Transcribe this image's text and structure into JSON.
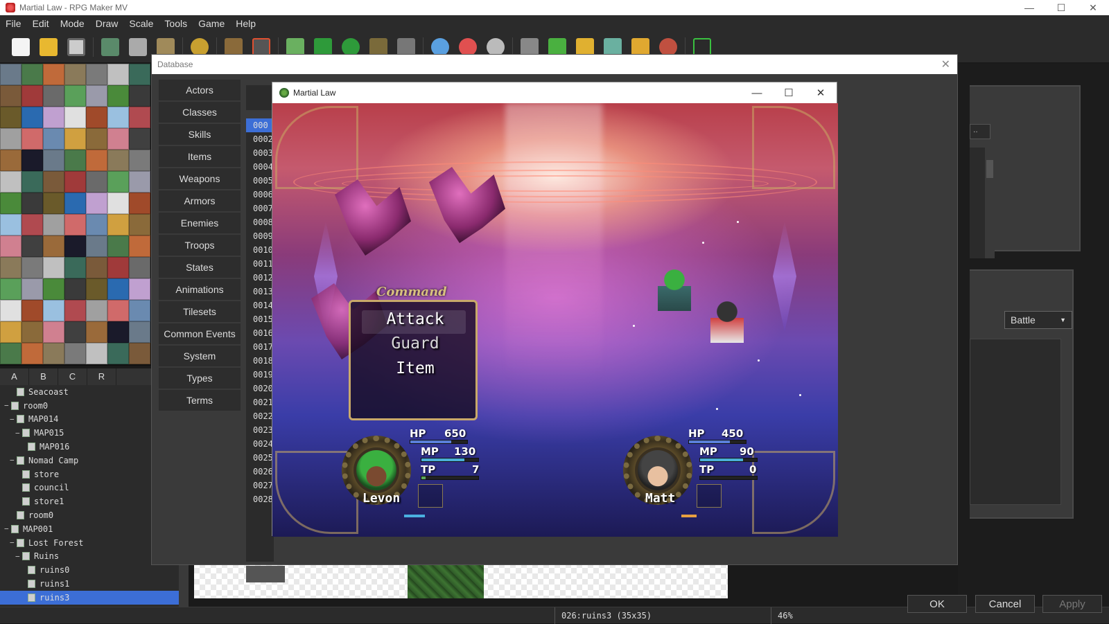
{
  "window": {
    "title": "Martial Law - RPG Maker MV",
    "min": "—",
    "max": "☐",
    "close": "✕"
  },
  "menu": [
    "File",
    "Edit",
    "Mode",
    "Draw",
    "Scale",
    "Tools",
    "Game",
    "Help"
  ],
  "tileset_tabs": [
    "A",
    "B",
    "C",
    "R"
  ],
  "map_tree": [
    {
      "label": "Seacoast",
      "depth": 2,
      "toggle": ""
    },
    {
      "label": "room0",
      "depth": 1,
      "toggle": "−"
    },
    {
      "label": "MAP014",
      "depth": 2,
      "toggle": "−"
    },
    {
      "label": "MAP015",
      "depth": 3,
      "toggle": "−"
    },
    {
      "label": "MAP016",
      "depth": 4,
      "toggle": ""
    },
    {
      "label": "Nomad Camp",
      "depth": 2,
      "toggle": "−"
    },
    {
      "label": "store",
      "depth": 3,
      "toggle": ""
    },
    {
      "label": "council",
      "depth": 3,
      "toggle": ""
    },
    {
      "label": "store1",
      "depth": 3,
      "toggle": ""
    },
    {
      "label": "room0",
      "depth": 2,
      "toggle": ""
    },
    {
      "label": "MAP001",
      "depth": 1,
      "toggle": "−"
    },
    {
      "label": "Lost Forest",
      "depth": 2,
      "toggle": "−"
    },
    {
      "label": "Ruins",
      "depth": 3,
      "toggle": "−"
    },
    {
      "label": "ruins0",
      "depth": 4,
      "toggle": ""
    },
    {
      "label": "ruins1",
      "depth": 4,
      "toggle": ""
    },
    {
      "label": "ruins3",
      "depth": 4,
      "toggle": "",
      "selected": true
    }
  ],
  "statusbar": {
    "map": "026:ruins3 (35x35)",
    "zoom": "46%"
  },
  "database": {
    "title": "Database",
    "close": "✕",
    "nav": [
      "Actors",
      "Classes",
      "Skills",
      "Items",
      "Weapons",
      "Armors",
      "Enemies",
      "Troops",
      "States",
      "Animations",
      "Tilesets",
      "Common Events",
      "System",
      "Types",
      "Terms"
    ],
    "ids": [
      "000",
      "0002",
      "0003",
      "0004",
      "0005",
      "0006",
      "0007",
      "0008",
      "0009",
      "0010",
      "0011",
      "0012",
      "0013",
      "0014",
      "0015",
      "0016",
      "0017",
      "0018",
      "0019",
      "0020",
      "0021",
      "0022",
      "0023",
      "0024",
      "0025",
      "0026",
      "0027",
      "0028"
    ],
    "field_stub": "..",
    "battle_select": "Battle",
    "ok": "OK",
    "cancel": "Cancel",
    "apply": "Apply"
  },
  "game": {
    "title": "Martial Law",
    "command_title": "Command",
    "commands": [
      "Attack",
      "Guard",
      "Item"
    ],
    "actors": [
      {
        "name": "Levon",
        "hp": "650",
        "mp": "130",
        "tp": "7",
        "hp_fill": 0.72,
        "mp_fill": 0.75,
        "tp_fill": 0.07
      },
      {
        "name": "Matt",
        "hp": "450",
        "mp": "90",
        "tp": "0",
        "hp_fill": 0.72,
        "mp_fill": 0.75,
        "tp_fill": 0.0
      }
    ],
    "labels": {
      "hp": "HP",
      "mp": "MP",
      "tp": "TP"
    }
  },
  "colors": {
    "accent": "#3c6ed6",
    "hp": "#5a7fd8",
    "mp": "#4ab0d6",
    "tp": "#5aa55a"
  }
}
